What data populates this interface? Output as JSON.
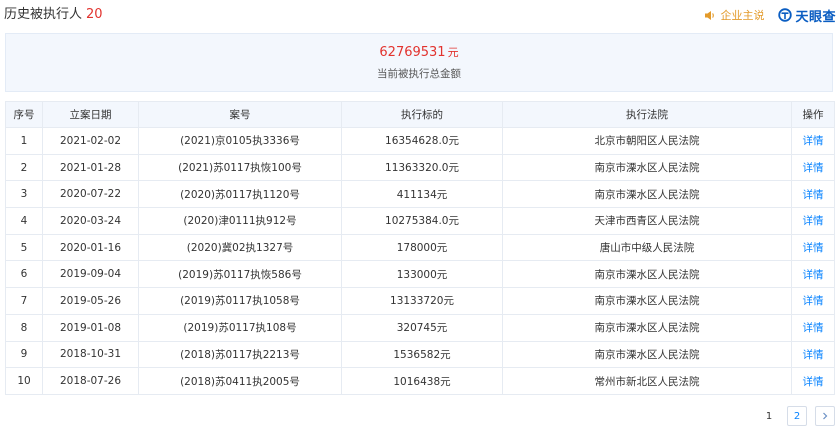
{
  "header": {
    "title": "历史被执行人",
    "count": "20",
    "claim_label": "企业主说",
    "logo_text": "天眼查",
    "accent_color": "#e2332e",
    "brand_color": "#0a5dc2",
    "link_color": "#0a84ff"
  },
  "summary": {
    "amount": "62769531",
    "unit": "元",
    "label": "当前被执行总金额"
  },
  "table": {
    "columns": [
      "序号",
      "立案日期",
      "案号",
      "执行标的",
      "执行法院",
      "操作"
    ],
    "rows": [
      {
        "no": "1",
        "date": "2021-02-02",
        "case": "(2021)京0105执3336号",
        "amount": "16354628.0元",
        "court": "北京市朝阳区人民法院",
        "action": "详情"
      },
      {
        "no": "2",
        "date": "2021-01-28",
        "case": "(2021)苏0117执恢100号",
        "amount": "11363320.0元",
        "court": "南京市溧水区人民法院",
        "action": "详情"
      },
      {
        "no": "3",
        "date": "2020-07-22",
        "case": "(2020)苏0117执1120号",
        "amount": "411134元",
        "court": "南京市溧水区人民法院",
        "action": "详情"
      },
      {
        "no": "4",
        "date": "2020-03-24",
        "case": "(2020)津0111执912号",
        "amount": "10275384.0元",
        "court": "天津市西青区人民法院",
        "action": "详情"
      },
      {
        "no": "5",
        "date": "2020-01-16",
        "case": "(2020)冀02执1327号",
        "amount": "178000元",
        "court": "唐山市中级人民法院",
        "action": "详情"
      },
      {
        "no": "6",
        "date": "2019-09-04",
        "case": "(2019)苏0117执恢586号",
        "amount": "133000元",
        "court": "南京市溧水区人民法院",
        "action": "详情"
      },
      {
        "no": "7",
        "date": "2019-05-26",
        "case": "(2019)苏0117执1058号",
        "amount": "13133720元",
        "court": "南京市溧水区人民法院",
        "action": "详情"
      },
      {
        "no": "8",
        "date": "2019-01-08",
        "case": "(2019)苏0117执108号",
        "amount": "320745元",
        "court": "南京市溧水区人民法院",
        "action": "详情"
      },
      {
        "no": "9",
        "date": "2018-10-31",
        "case": "(2018)苏0117执2213号",
        "amount": "1536582元",
        "court": "南京市溧水区人民法院",
        "action": "详情"
      },
      {
        "no": "10",
        "date": "2018-07-26",
        "case": "(2018)苏0411执2005号",
        "amount": "1016438元",
        "court": "常州市新北区人民法院",
        "action": "详情"
      }
    ]
  },
  "pagination": {
    "pages": [
      "1",
      "2"
    ],
    "current": "1",
    "next_icon": "chevron-right-icon"
  }
}
